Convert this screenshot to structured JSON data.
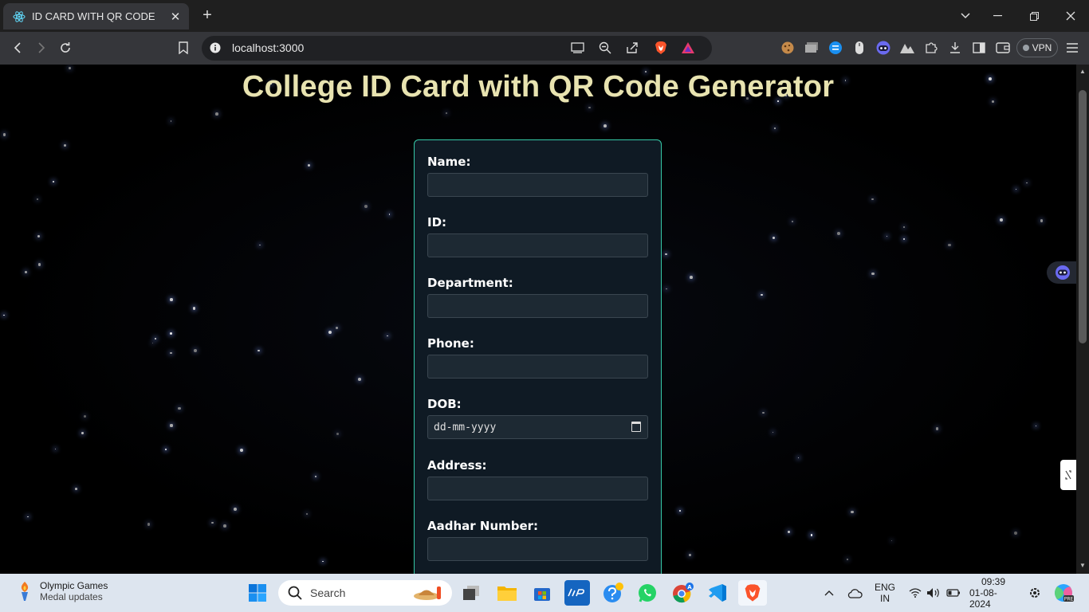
{
  "browser": {
    "tab_title": "ID CARD WITH QR CODE",
    "tab_close": "✕",
    "new_tab": "+",
    "url": "localhost:3000",
    "vpn_label": "VPN"
  },
  "page": {
    "heading": "College ID Card with QR Code Generator",
    "fields": [
      {
        "label": "Name:",
        "value": ""
      },
      {
        "label": "ID:",
        "value": ""
      },
      {
        "label": "Department:",
        "value": ""
      },
      {
        "label": "Phone:",
        "value": ""
      },
      {
        "label": "DOB:",
        "value": "dd-mm-yyyy"
      },
      {
        "label": "Address:",
        "value": ""
      },
      {
        "label": "Aadhar Number:",
        "value": ""
      }
    ]
  },
  "taskbar": {
    "weather_title": "Olympic Games",
    "weather_subtitle": "Medal updates",
    "search_placeholder": "Search",
    "language_top": "ENG",
    "language_bottom": "IN",
    "time": "09:39",
    "date": "01-08-2024"
  },
  "colors": {
    "heading": "#e8e3b0",
    "form_border": "#36c9a8",
    "form_bg": "#0f1a24",
    "input_bg": "#1d2933"
  }
}
